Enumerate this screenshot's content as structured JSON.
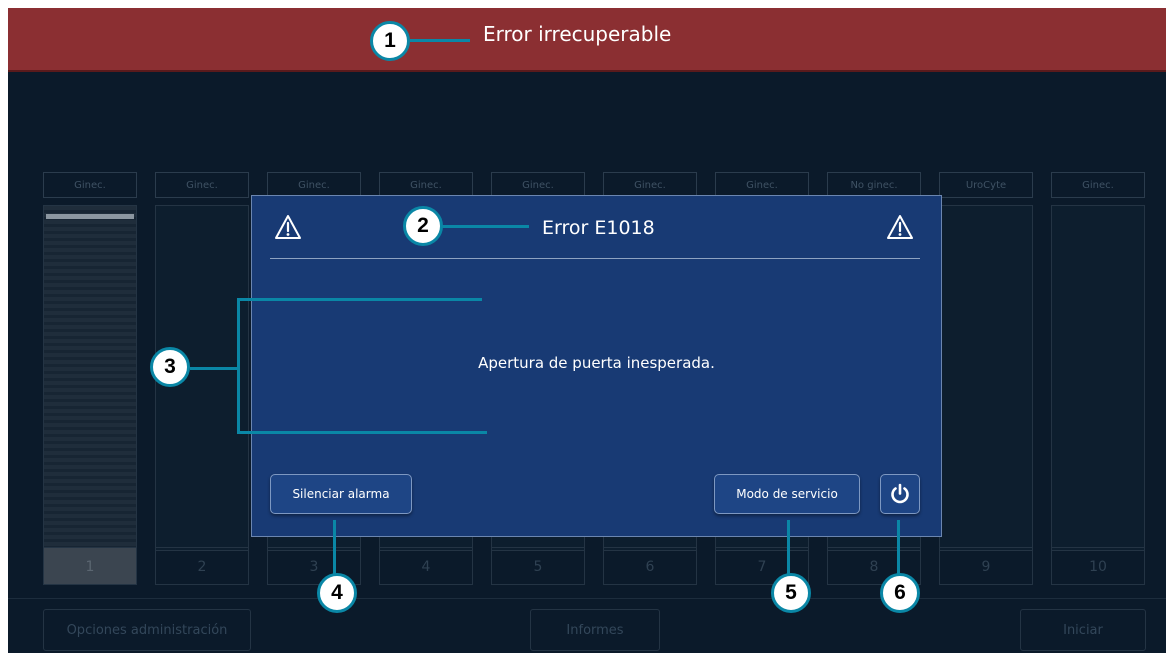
{
  "header": {
    "title": "Error irrecuperable"
  },
  "columns": [
    {
      "label": "Ginec.",
      "number": "1"
    },
    {
      "label": "Ginec.",
      "number": "2"
    },
    {
      "label": "Ginec.",
      "number": "3"
    },
    {
      "label": "Ginec.",
      "number": "4"
    },
    {
      "label": "Ginec.",
      "number": "5"
    },
    {
      "label": "Ginec.",
      "number": "6"
    },
    {
      "label": "Ginec.",
      "number": "7"
    },
    {
      "label": "No ginec.",
      "number": "8"
    },
    {
      "label": "UroCyte",
      "number": "9"
    },
    {
      "label": "Ginec.",
      "number": "10"
    }
  ],
  "footer": {
    "admin_label": "Opciones administración",
    "reports_label": "Informes",
    "start_label": "Iniciar"
  },
  "dialog": {
    "title": "Error E1018",
    "message": "Apertura de puerta inesperada.",
    "silence_label": "Silenciar alarma",
    "service_label": "Modo de servicio",
    "left_icon": "warning-icon",
    "right_icon": "warning-icon",
    "power_icon": "power-icon"
  },
  "callouts": [
    "1",
    "2",
    "3",
    "4",
    "5",
    "6"
  ],
  "colors": {
    "header_bg": "#8b2f32",
    "dialog_bg": "#183a74",
    "screen_bg": "#0b1a2a",
    "callout_line": "#0a87a6"
  }
}
